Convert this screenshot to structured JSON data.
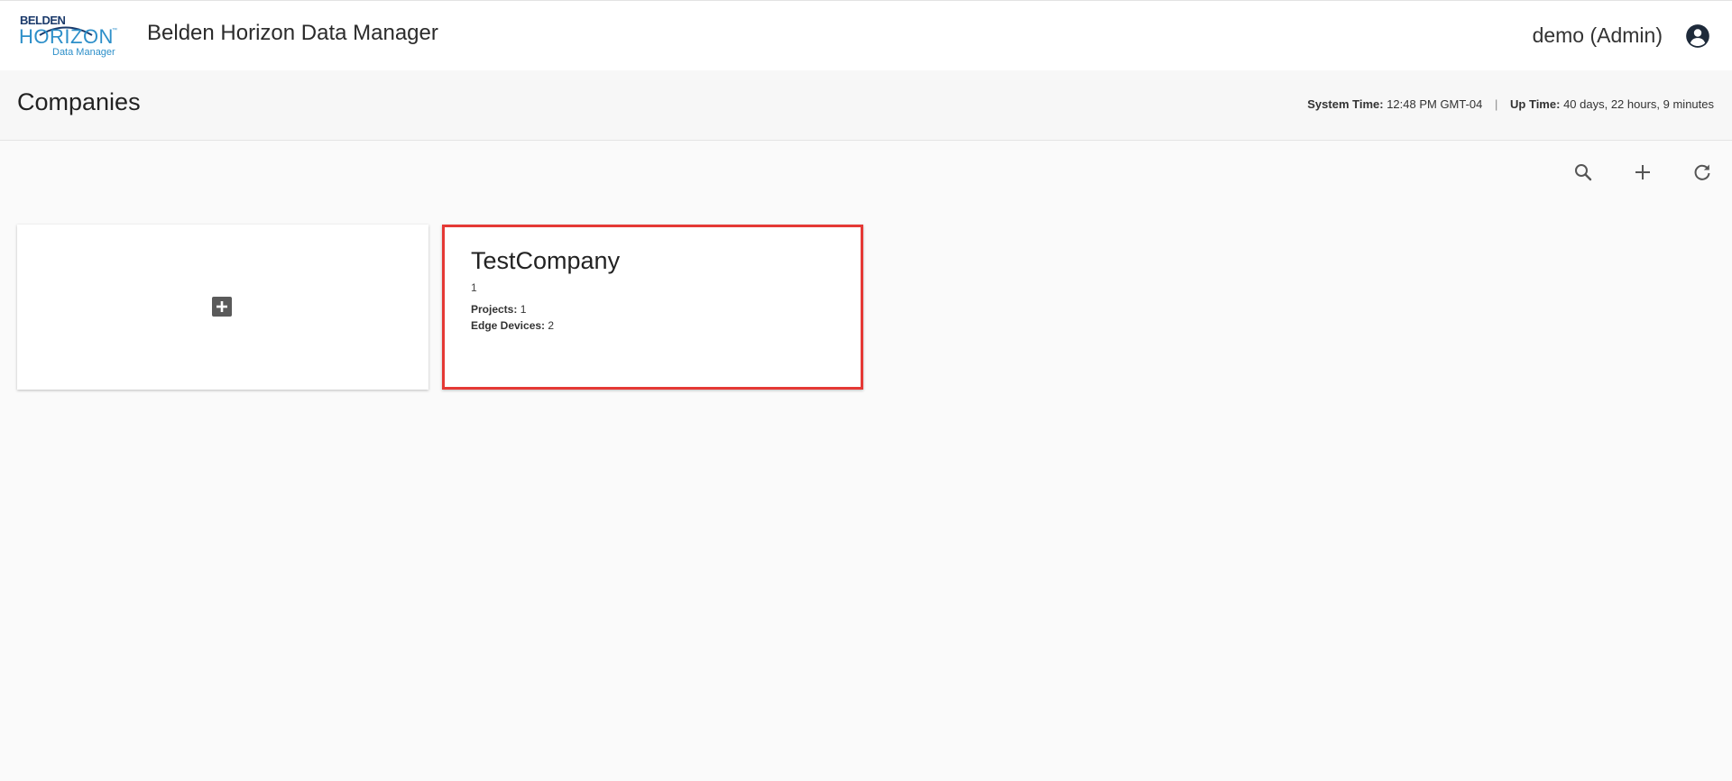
{
  "header": {
    "logo": {
      "brand_top": "BELDEN",
      "brand_main": "HORIZON",
      "brand_tm": "™",
      "brand_sub": "Data Manager"
    },
    "app_title": "Belden Horizon Data Manager",
    "user_label": "demo (Admin)",
    "account_icon": "account-circle-icon"
  },
  "subheader": {
    "page_title": "Companies",
    "system_time_label": "System Time:",
    "system_time_value": "12:48 PM GMT-04",
    "separator": "|",
    "up_time_label": "Up Time:",
    "up_time_value": "40 days, 22 hours, 9 minutes"
  },
  "toolbar": {
    "search_icon": "search-icon",
    "add_icon": "plus-icon",
    "refresh_icon": "refresh-icon"
  },
  "cards": {
    "add_card_icon": "add-box-icon",
    "companies": [
      {
        "name": "TestCompany",
        "id": "1",
        "projects_label": "Projects:",
        "projects_value": "1",
        "edge_devices_label": "Edge Devices:",
        "edge_devices_value": "2"
      }
    ]
  },
  "colors": {
    "brand_dark": "#1b3a6b",
    "brand_light": "#2d8fc9",
    "highlight_border": "#e53935",
    "icon_grey": "#555555"
  }
}
